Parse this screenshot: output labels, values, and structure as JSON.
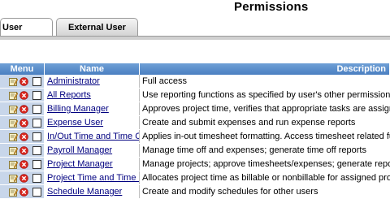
{
  "page": {
    "title": "Permissions"
  },
  "tabs": [
    {
      "label": "User",
      "active": true
    },
    {
      "label": "External User",
      "active": false
    }
  ],
  "table": {
    "headers": {
      "menu": "Menu",
      "name": "Name",
      "description": "Description"
    },
    "rows": [
      {
        "name": "Administrator",
        "description": "Full access"
      },
      {
        "name": "All Reports",
        "description": "Use reporting functions as specified by user's other permissions"
      },
      {
        "name": "Billing Manager",
        "description": "Approves project time, verifies that appropriate tasks are assigned as"
      },
      {
        "name": "Expense User",
        "description": "Create and submit expenses and run expense reports"
      },
      {
        "name": "In/Out Time and Time Off",
        "description": "Applies in-out timesheet formatting. Access timesheet related functio"
      },
      {
        "name": "Payroll Manager",
        "description": "Manage time off and expenses; generate time off reports"
      },
      {
        "name": "Project Manager",
        "description": "Manage projects; approve timesheets/expenses; generate reports"
      },
      {
        "name": "Project Time and Time Off",
        "description": "Allocates project time as billable or nonbillable for assigned projects"
      },
      {
        "name": "Schedule Manager",
        "description": "Create and modify schedules for other users"
      }
    ]
  },
  "colors": {
    "header_blue": "#4a7fc1",
    "menu_cell": "#c8d6ea",
    "link": "#000080",
    "delete_red": "#d9241c"
  },
  "icons": {
    "edit": "edit-icon",
    "delete": "delete-icon",
    "select": "checkbox"
  }
}
